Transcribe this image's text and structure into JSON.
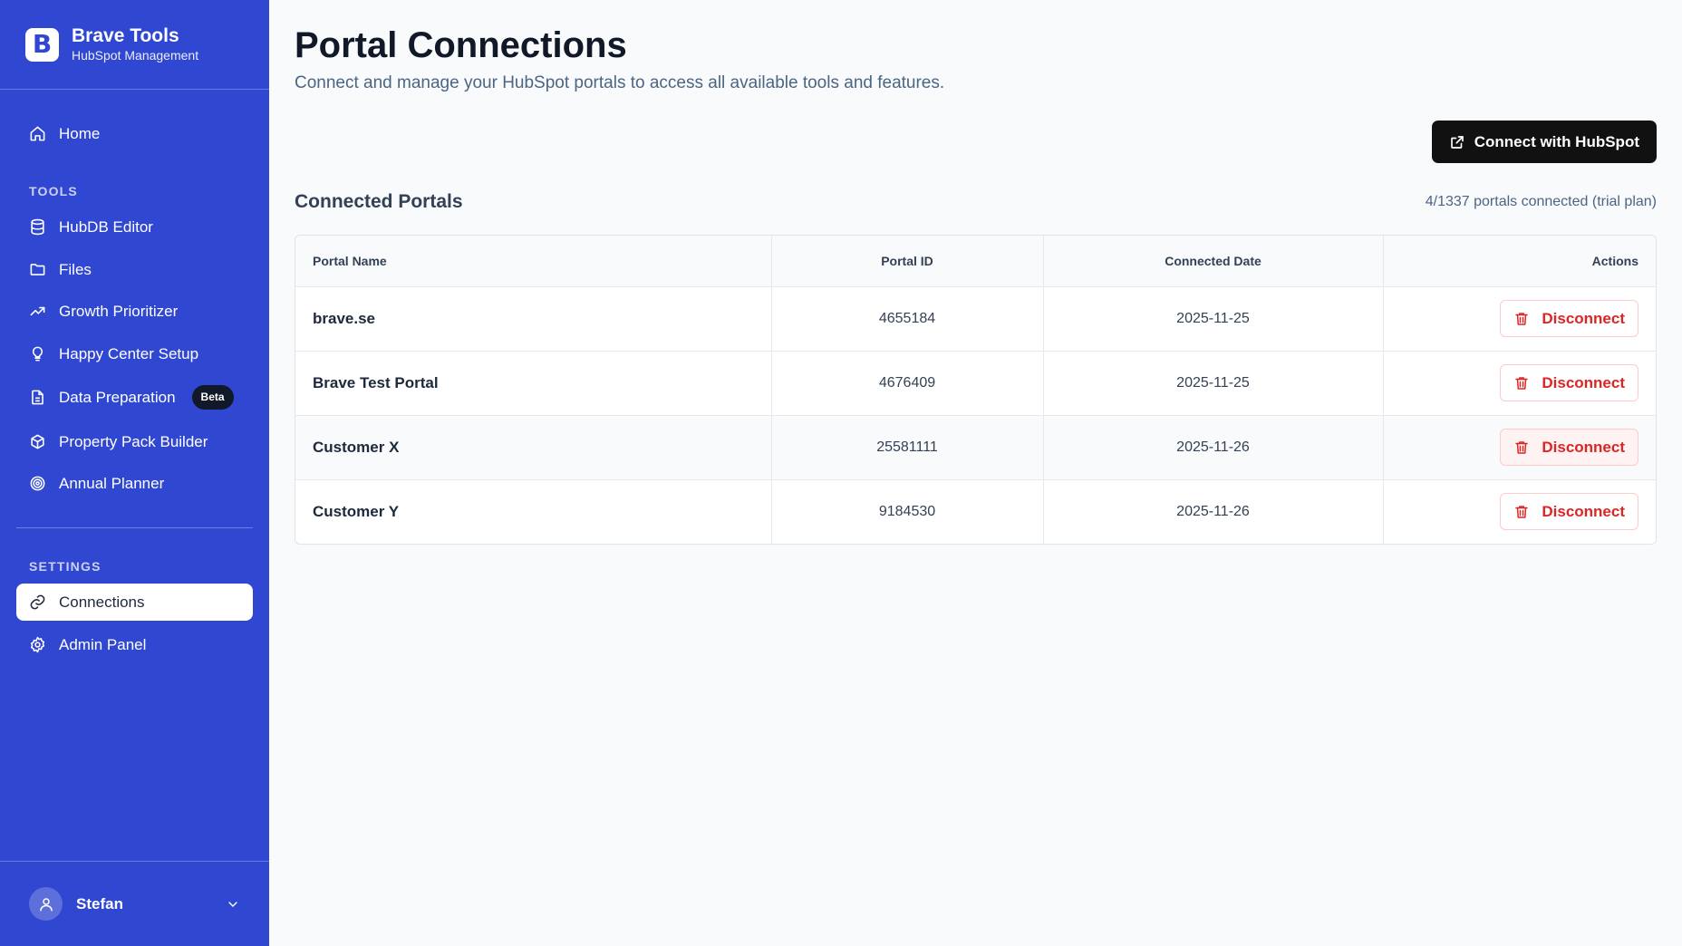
{
  "brand": {
    "logo_letter": "B",
    "title": "Brave Tools",
    "subtitle": "HubSpot Management"
  },
  "sidebar": {
    "home": {
      "label": "Home",
      "icon": "home-icon"
    },
    "tools_heading": "TOOLS",
    "tools": [
      {
        "label": "HubDB Editor",
        "icon": "database-icon"
      },
      {
        "label": "Files",
        "icon": "folder-icon"
      },
      {
        "label": "Growth Prioritizer",
        "icon": "trending-up-icon"
      },
      {
        "label": "Happy Center Setup",
        "icon": "lightbulb-icon"
      },
      {
        "label": "Data Preparation",
        "icon": "document-icon",
        "badge": "Beta"
      },
      {
        "label": "Property Pack Builder",
        "icon": "package-icon"
      },
      {
        "label": "Annual Planner",
        "icon": "target-icon"
      }
    ],
    "settings_heading": "SETTINGS",
    "settings": [
      {
        "label": "Connections",
        "icon": "link-icon",
        "active": true
      },
      {
        "label": "Admin Panel",
        "icon": "gear-icon"
      }
    ],
    "user": {
      "name": "Stefan"
    }
  },
  "main": {
    "title": "Portal Connections",
    "subtitle": "Connect and manage your HubSpot portals to access all available tools and features.",
    "connect_button": "Connect with HubSpot",
    "section_title": "Connected Portals",
    "portal_count": "4/1337 portals connected (trial plan)",
    "table": {
      "headers": [
        "Portal Name",
        "Portal ID",
        "Connected Date",
        "Actions"
      ],
      "rows": [
        {
          "name": "brave.se",
          "id": "4655184",
          "date": "2025-11-25",
          "action": "Disconnect"
        },
        {
          "name": "Brave Test Portal",
          "id": "4676409",
          "date": "2025-11-25",
          "action": "Disconnect"
        },
        {
          "name": "Customer X",
          "id": "25581111",
          "date": "2025-11-26",
          "action": "Disconnect"
        },
        {
          "name": "Customer Y",
          "id": "9184530",
          "date": "2025-11-26",
          "action": "Disconnect"
        }
      ]
    }
  },
  "colors": {
    "sidebar_bg": "#3047d1",
    "page_bg": "#f8fafc",
    "primary_button": "#111111",
    "danger": "#dc2626",
    "danger_border": "#fecaca"
  }
}
